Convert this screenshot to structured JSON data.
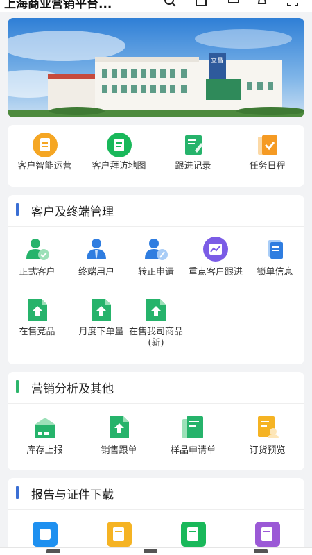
{
  "header": {
    "title": "上海商业营销平台..."
  },
  "quick_actions": [
    {
      "label": "客户智能运营",
      "icon": "document-icon",
      "color": "#f5a623"
    },
    {
      "label": "客户拜访地图",
      "icon": "map-document-icon",
      "color": "#19b85a"
    },
    {
      "label": "跟进记录",
      "icon": "edit-note-icon",
      "color": "#26b36b"
    },
    {
      "label": "任务日程",
      "icon": "task-check-icon",
      "color": "#f59a23"
    }
  ],
  "sections": {
    "customer": {
      "title": "客户及终端管理",
      "accent": "#3b6fd4",
      "items": [
        {
          "label": "正式客户",
          "icon": "user-check-icon"
        },
        {
          "label": "终端用户",
          "icon": "user-tie-icon"
        },
        {
          "label": "转正申请",
          "icon": "user-edit-icon"
        },
        {
          "label": "重点客户跟进",
          "icon": "chart-circle-icon"
        },
        {
          "label": "锁单信息",
          "icon": "lock-doc-icon"
        },
        {
          "label": "在售竞品",
          "icon": "upload-file-icon"
        },
        {
          "label": "月度下单量",
          "icon": "upload-file-icon"
        },
        {
          "label": "在售我司商品\n(新)",
          "icon": "upload-file-icon"
        }
      ]
    },
    "marketing": {
      "title": "营销分析及其他",
      "accent": "#2db56b",
      "items": [
        {
          "label": "库存上报",
          "icon": "warehouse-icon"
        },
        {
          "label": "销售跟单",
          "icon": "upload-file-icon"
        },
        {
          "label": "样品申请单",
          "icon": "sample-form-icon"
        },
        {
          "label": "订货预览",
          "icon": "order-preview-icon"
        }
      ]
    },
    "reports": {
      "title": "报告与证件下载",
      "accent": "#3b6fd4",
      "items": [
        {
          "icon": "blue-square-icon"
        },
        {
          "icon": "yellow-doc-icon"
        },
        {
          "icon": "green-search-doc-icon"
        },
        {
          "icon": "purple-search-doc-icon"
        }
      ]
    }
  },
  "banner": {
    "sign_text": "立昌"
  }
}
